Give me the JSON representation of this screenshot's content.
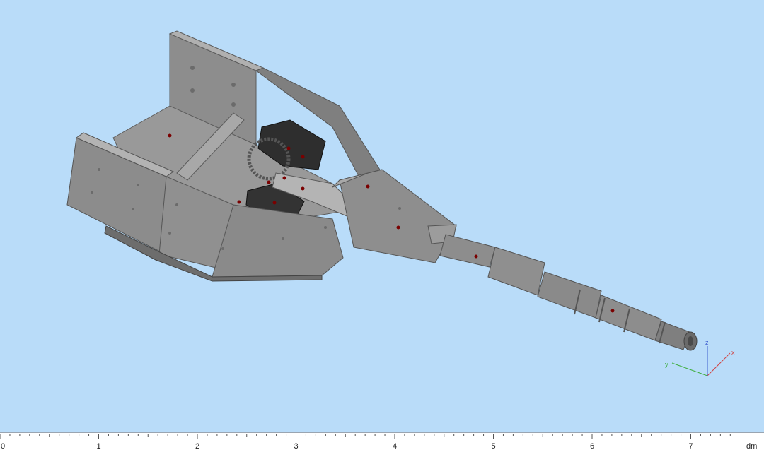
{
  "viewport": {
    "background": "#b9dcf9",
    "model_color": "#8a8a8a",
    "model_dark": "#2e2e2e",
    "marker_color": "#7a0000"
  },
  "triad": {
    "x_label": "x",
    "y_label": "y",
    "z_label": "z",
    "x_color": "#d04545",
    "y_color": "#3fae3f",
    "z_color": "#3f5fd0"
  },
  "ruler": {
    "ticks": [
      "0",
      "1",
      "2",
      "3",
      "4",
      "5",
      "6",
      "7"
    ],
    "unit": "dm"
  }
}
